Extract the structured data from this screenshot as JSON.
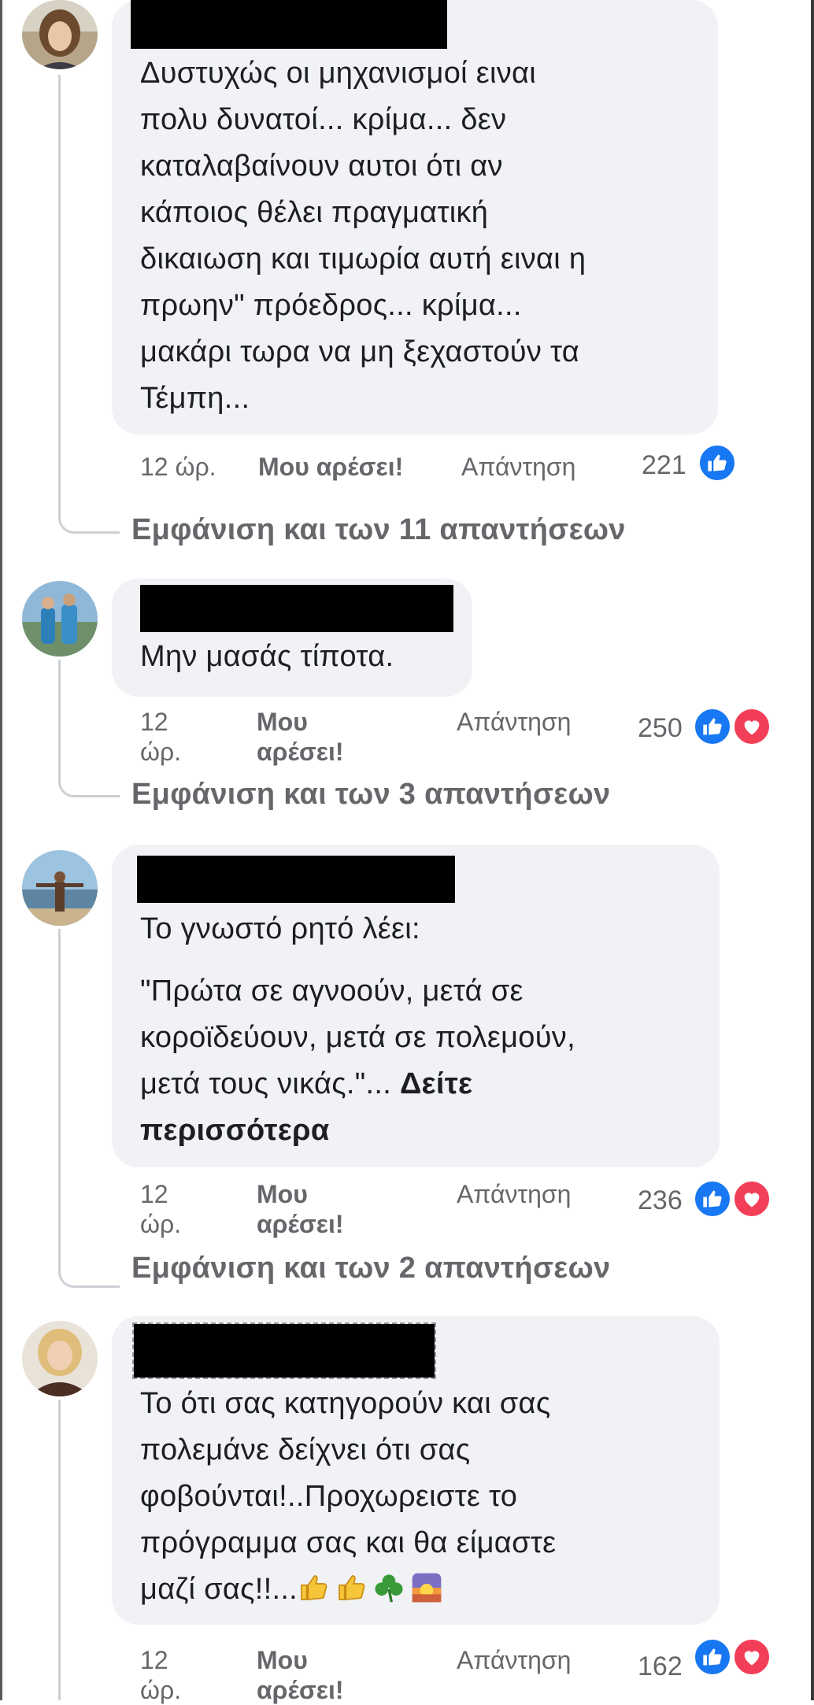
{
  "comments": [
    {
      "text_lines": [
        "Δυστυχώς οι μηχανισμοί ειναι",
        "πολυ δυνατοί... κρίμα... δεν",
        "καταλαβαίνουν αυτοι ότι αν",
        "κάποιος θέλει πραγματική",
        "δικαιωση και τιμωρία αυτή ειναι η",
        "πρωην\" πρόεδρος... κρίμα...",
        "μακάρι τωρα να μη ξεχαστούν τα",
        "Τέμπη..."
      ],
      "time": "12 ώρ.",
      "like_label": "Μου αρέσει!",
      "reply_label": "Απάντηση",
      "reaction_count": "221",
      "reactions": [
        "like-icon"
      ],
      "view_replies": "Εμφάνιση και των 11 απαντήσεων"
    },
    {
      "text_lines": [
        "Μην μασάς τίποτα."
      ],
      "time_line1": "12",
      "time_line2": "ώρ.",
      "like_line1": "Μου",
      "like_line2": "αρέσει!",
      "reply_label": "Απάντηση",
      "reaction_count": "250",
      "reactions": [
        "like-icon",
        "love-icon"
      ],
      "view_replies": "Εμφάνιση και των 3 απαντήσεων"
    },
    {
      "intro": "Το γνωστό ρητό λέει:",
      "quote_lines": [
        "\"Πρώτα σε αγνοούν, μετά σε",
        "κοροϊδεύουν, μετά σε πολεμούν,",
        "μετά τους νικάς.\"..."
      ],
      "see_more": "Δείτε περισσότερα",
      "see_more_line1": "Δείτε",
      "see_more_line2": "περισσότερα",
      "time_line1": "12",
      "time_line2": "ώρ.",
      "like_line1": "Μου",
      "like_line2": "αρέσει!",
      "reply_label": "Απάντηση",
      "reaction_count": "236",
      "reactions": [
        "like-icon",
        "love-icon"
      ],
      "view_replies": "Εμφάνιση και των 2 απαντήσεων"
    },
    {
      "text_lines": [
        "Το ότι σας κατηγορούν και σας",
        "πολεμάνε δείχνει ότι σας",
        "φοβούνται!..Προχωρειστε το",
        "πρόγραμμα σας και θα είμαστε",
        "μαζί σας!!..."
      ],
      "emojis": [
        "thumbs-up-emoji",
        "thumbs-up-emoji",
        "shamrock-emoji",
        "sunrise-emoji"
      ],
      "time_line1": "12",
      "time_line2": "ώρ.",
      "like_line1": "Μου",
      "like_line2": "αρέσει!",
      "reply_label": "Απάντηση",
      "reaction_count": "162",
      "reactions": [
        "like-icon",
        "love-icon"
      ]
    }
  ],
  "colors": {
    "bubble": "#f0f2f5",
    "text": "#1c1e21",
    "meta": "#65676b",
    "like": "#1877f2",
    "love": "#f33e58",
    "thread_line": "#ccd0d5"
  }
}
